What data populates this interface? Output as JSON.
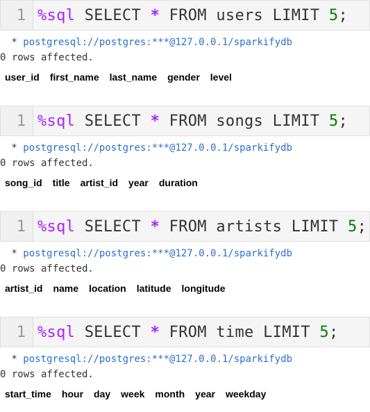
{
  "cells": [
    {
      "line_number": "1",
      "magic": "%sql",
      "before_star": " SELECT ",
      "star": "*",
      "after_star": " FROM users LIMIT ",
      "number": "5",
      "end": ";",
      "connection_prefix": " * ",
      "connection_url": "postgresql://postgres:***@127.0.0.1/sparkifydb",
      "rows_affected": "0 rows affected.",
      "columns": [
        "user_id",
        "first_name",
        "last_name",
        "gender",
        "level"
      ]
    },
    {
      "line_number": "1",
      "magic": "%sql",
      "before_star": " SELECT ",
      "star": "*",
      "after_star": " FROM songs LIMIT ",
      "number": "5",
      "end": ";",
      "connection_prefix": " * ",
      "connection_url": "postgresql://postgres:***@127.0.0.1/sparkifydb",
      "rows_affected": "0 rows affected.",
      "columns": [
        "song_id",
        "title",
        "artist_id",
        "year",
        "duration"
      ]
    },
    {
      "line_number": "1",
      "magic": "%sql",
      "before_star": " SELECT ",
      "star": "*",
      "after_star": " FROM artists LIMIT ",
      "number": "5",
      "end": ";",
      "connection_prefix": " * ",
      "connection_url": "postgresql://postgres:***@127.0.0.1/sparkifydb",
      "rows_affected": "0 rows affected.",
      "columns": [
        "artist_id",
        "name",
        "location",
        "latitude",
        "longitude"
      ]
    },
    {
      "line_number": "1",
      "magic": "%sql",
      "before_star": " SELECT ",
      "star": "*",
      "after_star": " FROM time LIMIT ",
      "number": "5",
      "end": ";",
      "connection_prefix": " * ",
      "connection_url": "postgresql://postgres:***@127.0.0.1/sparkifydb",
      "rows_affected": "0 rows affected.",
      "columns": [
        "start_time",
        "hour",
        "day",
        "week",
        "month",
        "year",
        "weekday"
      ]
    }
  ]
}
